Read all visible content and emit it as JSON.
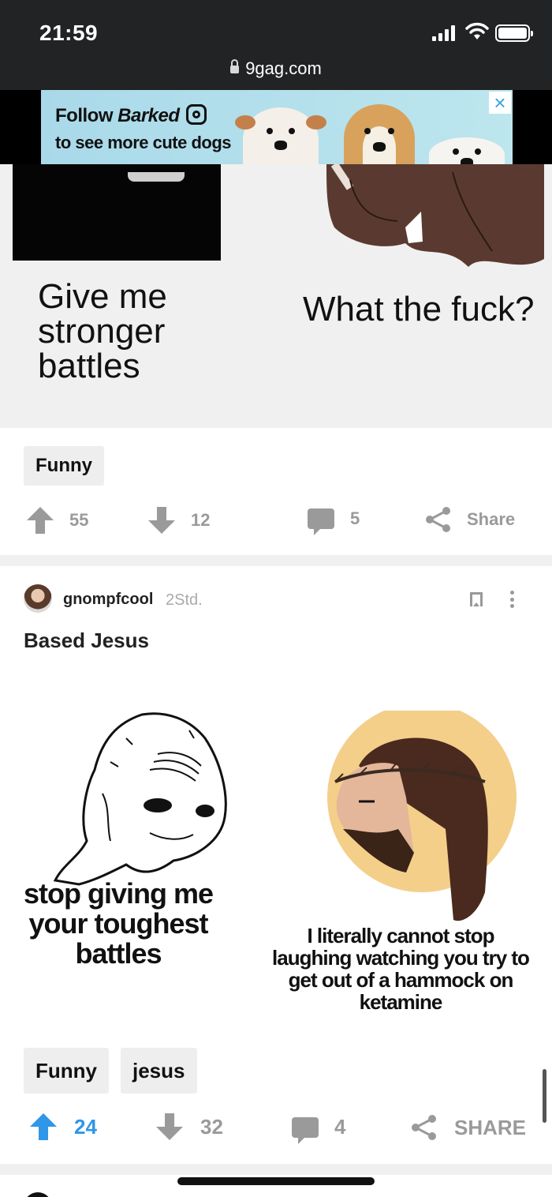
{
  "status_bar": {
    "time": "21:59",
    "url": "9gag.com"
  },
  "ad": {
    "line1_prefix": "Follow ",
    "line1_brand": "Barked",
    "line2": "to see more cute dogs",
    "close": "×"
  },
  "post1": {
    "caption_left": "Give me stronger battles",
    "caption_right": "What the fuck?",
    "tags": [
      "Funny"
    ],
    "upvotes": "55",
    "downvotes": "12",
    "comments": "5",
    "share_label": "Share"
  },
  "post2": {
    "username": "gnompfcool",
    "time_ago": "2Std.",
    "title": "Based Jesus",
    "caption_left": "stop giving me your toughest battles",
    "caption_right": "I literally cannot stop laughing watching you try to get out of a hammock on ketamine",
    "tags": [
      "Funny",
      "jesus"
    ],
    "upvotes": "24",
    "downvotes": "32",
    "comments": "4",
    "share_label": "SHARE"
  },
  "colors": {
    "status_bar": "#222324",
    "upvote_active": "#2f96e8",
    "icon_gray": "#9a9a9a",
    "halo": "#f3cf8a"
  }
}
